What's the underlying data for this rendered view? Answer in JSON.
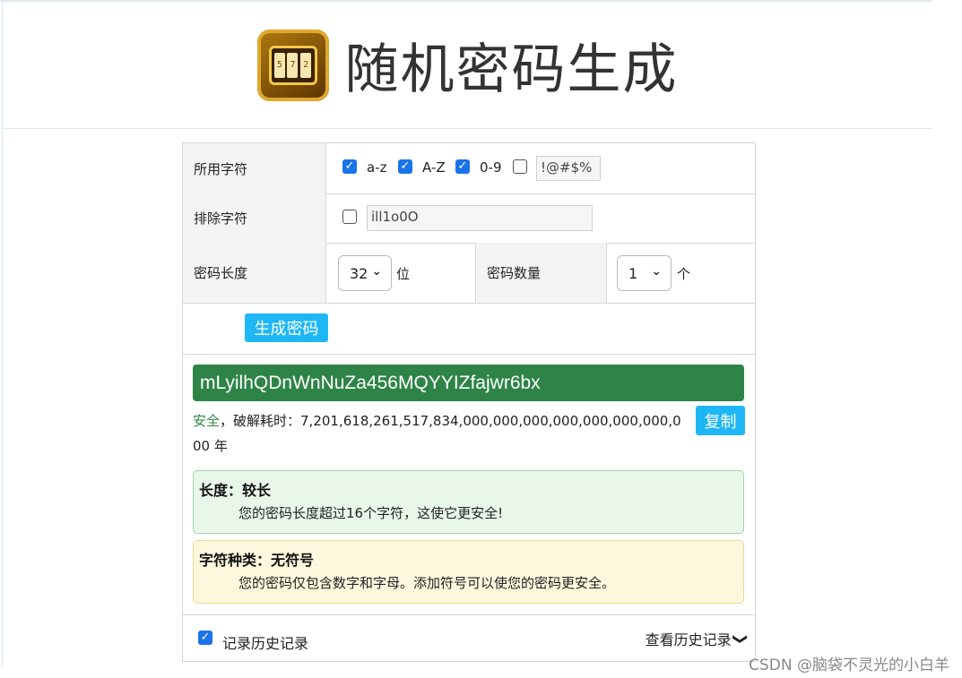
{
  "header": {
    "title": "随机密码生成"
  },
  "charset_row": {
    "label": "所用字符",
    "options": [
      {
        "label": "a-z",
        "checked": true
      },
      {
        "label": "A-Z",
        "checked": true
      },
      {
        "label": "0-9",
        "checked": true
      },
      {
        "label": "!@#$%",
        "checked": false
      }
    ]
  },
  "exclude_row": {
    "label": "排除字符",
    "checked": false,
    "value": "ill1o0O"
  },
  "length_row": {
    "label": "密码长度",
    "length_value": "32",
    "length_unit": "位",
    "count_label": "密码数量",
    "count_value": "1",
    "count_unit": "个"
  },
  "generate_button": "生成密码",
  "result": {
    "password": "mLyilhQDnWnNuZa456MQYYIZfajwr6bx",
    "safety": "安全",
    "crack_text": "，破解耗时：7,201,618,261,517,834,000,000,000,000,000,000,000,000 年",
    "copy_button": "复制"
  },
  "tips": [
    {
      "title": "长度：较长",
      "desc": "您的密码长度超过16个字符，这使它更安全!"
    },
    {
      "title": "字符种类：无符号",
      "desc": "您的密码仅包含数字和字母。添加符号可以使您的密码更安全。"
    }
  ],
  "footer": {
    "record_label": "记录历史记录",
    "record_checked": true,
    "view_history": "查看历史记录"
  },
  "watermark": "CSDN @脑袋不灵光的小白羊",
  "colors": {
    "accent": "#1fb6f5",
    "password_bg": "#2e8447",
    "safety_text": "#2e8447"
  }
}
